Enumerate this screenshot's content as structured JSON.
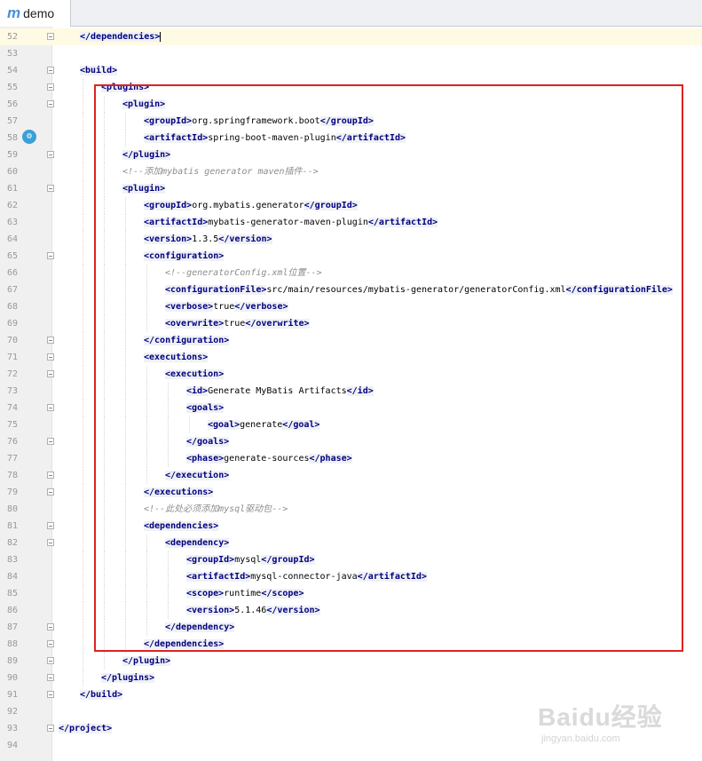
{
  "tab": {
    "icon": "maven-m-icon",
    "icon_text": "m",
    "label": "demo"
  },
  "lines": [
    {
      "n": "52",
      "indent": 1,
      "fold": true,
      "current": true,
      "parts": [
        {
          "t": "tag",
          "v": "</dependencies>"
        }
      ]
    },
    {
      "n": "53",
      "indent": 0,
      "fold": false,
      "parts": []
    },
    {
      "n": "54",
      "indent": 1,
      "fold": true,
      "parts": [
        {
          "t": "tag",
          "v": "<build>"
        }
      ]
    },
    {
      "n": "55",
      "indent": 2,
      "fold": true,
      "parts": [
        {
          "t": "tag",
          "v": "<plugins>"
        }
      ]
    },
    {
      "n": "56",
      "indent": 3,
      "fold": true,
      "parts": [
        {
          "t": "tag",
          "v": "<plugin>"
        }
      ]
    },
    {
      "n": "57",
      "indent": 4,
      "fold": false,
      "parts": [
        {
          "t": "tag",
          "v": "<groupId>"
        },
        {
          "t": "val",
          "v": "org.springframework.boot"
        },
        {
          "t": "tag",
          "v": "</groupId>"
        }
      ]
    },
    {
      "n": "58",
      "indent": 4,
      "fold": false,
      "parts": [
        {
          "t": "tag",
          "v": "<artifactId>"
        },
        {
          "t": "val",
          "v": "spring-boot-maven-plugin"
        },
        {
          "t": "tag",
          "v": "</artifactId>"
        }
      ]
    },
    {
      "n": "59",
      "indent": 3,
      "fold": true,
      "parts": [
        {
          "t": "tag",
          "v": "</plugin>"
        }
      ]
    },
    {
      "n": "60",
      "indent": 3,
      "fold": false,
      "parts": [
        {
          "t": "cmt",
          "v": "<!--添加mybatis generator maven插件-->"
        }
      ]
    },
    {
      "n": "61",
      "indent": 3,
      "fold": true,
      "parts": [
        {
          "t": "tag",
          "v": "<plugin>"
        }
      ]
    },
    {
      "n": "62",
      "indent": 4,
      "fold": false,
      "parts": [
        {
          "t": "tag",
          "v": "<groupId>"
        },
        {
          "t": "val",
          "v": "org.mybatis.generator"
        },
        {
          "t": "tag",
          "v": "</groupId>"
        }
      ]
    },
    {
      "n": "63",
      "indent": 4,
      "fold": false,
      "parts": [
        {
          "t": "tag",
          "v": "<artifactId>"
        },
        {
          "t": "val",
          "v": "mybatis-generator-maven-plugin"
        },
        {
          "t": "tag",
          "v": "</artifactId>"
        }
      ]
    },
    {
      "n": "64",
      "indent": 4,
      "fold": false,
      "parts": [
        {
          "t": "tag",
          "v": "<version>"
        },
        {
          "t": "val",
          "v": "1.3.5"
        },
        {
          "t": "tag",
          "v": "</version>"
        }
      ]
    },
    {
      "n": "65",
      "indent": 4,
      "fold": true,
      "parts": [
        {
          "t": "tag",
          "v": "<configuration>"
        }
      ]
    },
    {
      "n": "66",
      "indent": 5,
      "fold": false,
      "parts": [
        {
          "t": "cmt",
          "v": "<!--generatorConfig.xml位置-->"
        }
      ]
    },
    {
      "n": "67",
      "indent": 5,
      "fold": false,
      "parts": [
        {
          "t": "tag",
          "v": "<configurationFile>"
        },
        {
          "t": "val",
          "v": "src/main/resources/mybatis-generator/generatorConfig.xml"
        },
        {
          "t": "tag",
          "v": "</configurationFile>"
        }
      ]
    },
    {
      "n": "68",
      "indent": 5,
      "fold": false,
      "parts": [
        {
          "t": "tag",
          "v": "<verbose>"
        },
        {
          "t": "val",
          "v": "true"
        },
        {
          "t": "tag",
          "v": "</verbose>"
        }
      ]
    },
    {
      "n": "69",
      "indent": 5,
      "fold": false,
      "parts": [
        {
          "t": "tag",
          "v": "<overwrite>"
        },
        {
          "t": "val",
          "v": "true"
        },
        {
          "t": "tag",
          "v": "</overwrite>"
        }
      ]
    },
    {
      "n": "70",
      "indent": 4,
      "fold": true,
      "parts": [
        {
          "t": "tag",
          "v": "</configuration>"
        }
      ]
    },
    {
      "n": "71",
      "indent": 4,
      "fold": true,
      "parts": [
        {
          "t": "tag",
          "v": "<executions>"
        }
      ]
    },
    {
      "n": "72",
      "indent": 5,
      "fold": true,
      "parts": [
        {
          "t": "tag",
          "v": "<execution>"
        }
      ]
    },
    {
      "n": "73",
      "indent": 6,
      "fold": false,
      "parts": [
        {
          "t": "tag",
          "v": "<id>"
        },
        {
          "t": "val",
          "v": "Generate MyBatis Artifacts"
        },
        {
          "t": "tag",
          "v": "</id>"
        }
      ]
    },
    {
      "n": "74",
      "indent": 6,
      "fold": true,
      "parts": [
        {
          "t": "tag",
          "v": "<goals>"
        }
      ]
    },
    {
      "n": "75",
      "indent": 7,
      "fold": false,
      "parts": [
        {
          "t": "tag",
          "v": "<goal>"
        },
        {
          "t": "val",
          "v": "generate"
        },
        {
          "t": "tag",
          "v": "</goal>"
        }
      ]
    },
    {
      "n": "76",
      "indent": 6,
      "fold": true,
      "parts": [
        {
          "t": "tag",
          "v": "</goals>"
        }
      ]
    },
    {
      "n": "77",
      "indent": 6,
      "fold": false,
      "parts": [
        {
          "t": "tag",
          "v": "<phase>"
        },
        {
          "t": "val",
          "v": "generate-sources"
        },
        {
          "t": "tag",
          "v": "</phase>"
        }
      ]
    },
    {
      "n": "78",
      "indent": 5,
      "fold": true,
      "parts": [
        {
          "t": "tag",
          "v": "</execution>"
        }
      ]
    },
    {
      "n": "79",
      "indent": 4,
      "fold": true,
      "parts": [
        {
          "t": "tag",
          "v": "</executions>"
        }
      ]
    },
    {
      "n": "80",
      "indent": 4,
      "fold": false,
      "parts": [
        {
          "t": "cmt",
          "v": "<!--此处必须添加mysql驱动包-->"
        }
      ]
    },
    {
      "n": "81",
      "indent": 4,
      "fold": true,
      "parts": [
        {
          "t": "tag",
          "v": "<dependencies>"
        }
      ]
    },
    {
      "n": "82",
      "indent": 5,
      "fold": true,
      "parts": [
        {
          "t": "tag",
          "v": "<dependency>"
        }
      ]
    },
    {
      "n": "83",
      "indent": 6,
      "fold": false,
      "parts": [
        {
          "t": "tag",
          "v": "<groupId>"
        },
        {
          "t": "val",
          "v": "mysql"
        },
        {
          "t": "tag",
          "v": "</groupId>"
        }
      ]
    },
    {
      "n": "84",
      "indent": 6,
      "fold": false,
      "parts": [
        {
          "t": "tag",
          "v": "<artifactId>"
        },
        {
          "t": "val",
          "v": "mysql-connector-java"
        },
        {
          "t": "tag",
          "v": "</artifactId>"
        }
      ]
    },
    {
      "n": "85",
      "indent": 6,
      "fold": false,
      "parts": [
        {
          "t": "tag",
          "v": "<scope>"
        },
        {
          "t": "val",
          "v": "runtime"
        },
        {
          "t": "tag",
          "v": "</scope>"
        }
      ]
    },
    {
      "n": "86",
      "indent": 6,
      "fold": false,
      "parts": [
        {
          "t": "tag",
          "v": "<version>"
        },
        {
          "t": "val",
          "v": "5.1.46"
        },
        {
          "t": "tag",
          "v": "</version>"
        }
      ]
    },
    {
      "n": "87",
      "indent": 5,
      "fold": true,
      "parts": [
        {
          "t": "tag",
          "v": "</dependency>"
        }
      ]
    },
    {
      "n": "88",
      "indent": 4,
      "fold": true,
      "parts": [
        {
          "t": "tag",
          "v": "</dependencies>"
        }
      ]
    },
    {
      "n": "89",
      "indent": 3,
      "fold": true,
      "parts": [
        {
          "t": "tag",
          "v": "</plugin>"
        }
      ]
    },
    {
      "n": "90",
      "indent": 2,
      "fold": true,
      "parts": [
        {
          "t": "tag",
          "v": "</plugins>"
        }
      ]
    },
    {
      "n": "91",
      "indent": 1,
      "fold": true,
      "parts": [
        {
          "t": "tag",
          "v": "</build>"
        }
      ]
    },
    {
      "n": "92",
      "indent": 0,
      "fold": false,
      "parts": []
    },
    {
      "n": "93",
      "indent": 0,
      "fold": true,
      "parts": [
        {
          "t": "tag",
          "v": "</project>"
        }
      ]
    },
    {
      "n": "94",
      "indent": 0,
      "fold": false,
      "parts": []
    }
  ],
  "gutter_marker": {
    "icon": "run-gutter-icon",
    "line": "58"
  },
  "annotation": {
    "type": "red-rectangle",
    "color": "#dd2222"
  },
  "watermark": {
    "main": "Baidu经验",
    "sub": "jingyan.baidu.com"
  }
}
